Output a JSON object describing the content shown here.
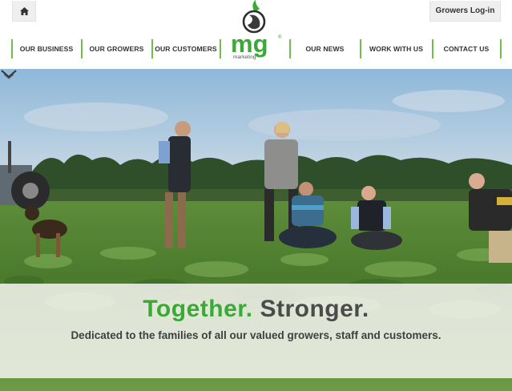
{
  "header": {
    "home_icon": "home-icon",
    "login_label": "Growers Log-in",
    "logo": {
      "mark": "mg",
      "tagline": "marketing"
    },
    "nav_left": [
      {
        "label": "OUR BUSINESS"
      },
      {
        "label": "OUR GROWERS"
      },
      {
        "label": "OUR CUSTOMERS"
      }
    ],
    "nav_right": [
      {
        "label": "OUR NEWS"
      },
      {
        "label": "WORK WITH US"
      },
      {
        "label": "CONTACT US"
      }
    ]
  },
  "hero": {
    "headline_part1": "Together.",
    "headline_part2": "Stronger.",
    "subheadline": "Dedicated to the families of all our valued growers, staff and customers.",
    "scroll_icon": "chevron-down-icon"
  },
  "colors": {
    "brand_green": "#3aa935",
    "nav_separator": "#6fbf4a",
    "text_dark": "#333333"
  }
}
